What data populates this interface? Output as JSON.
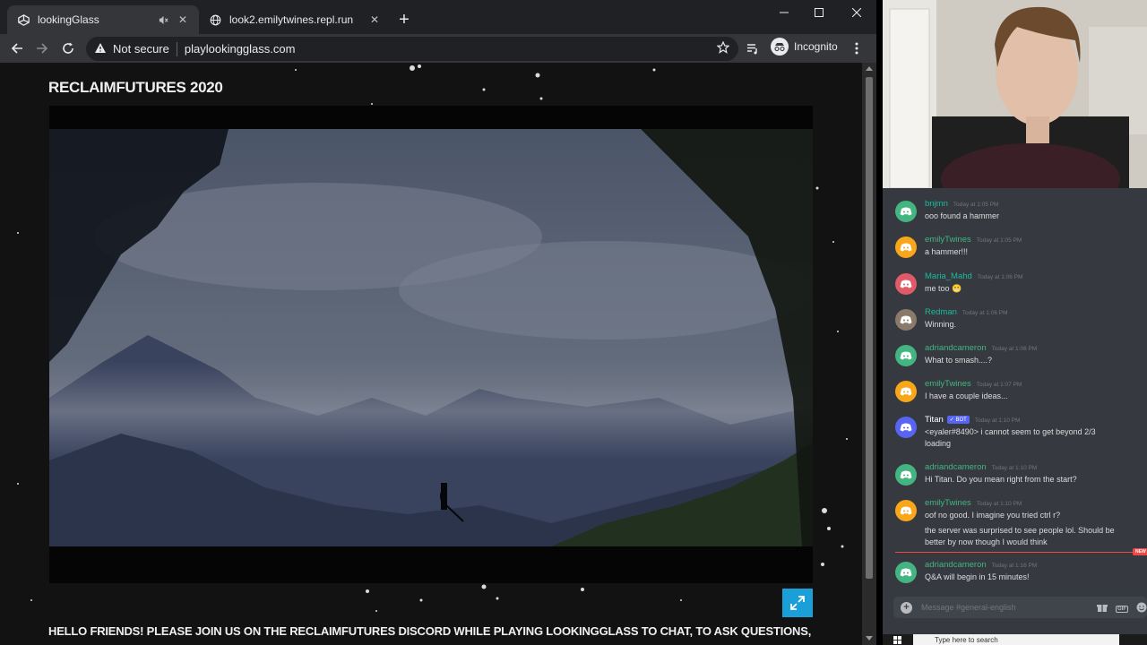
{
  "browser": {
    "tabs": [
      {
        "title": "lookingGlass",
        "active": true,
        "muted": true
      },
      {
        "title": "look2.emilytwines.repl.run",
        "active": false
      }
    ],
    "security_label": "Not secure",
    "url": "playlookingglass.com",
    "profile_label": "Incognito"
  },
  "page": {
    "title": "RECLAIMFUTURES 2020",
    "announcement": "HELLO FRIENDS! PLEASE JOIN US ON THE RECLAIMFUTURES DISCORD WHILE PLAYING LOOKINGGLASS TO CHAT, TO ASK QUESTIONS,"
  },
  "discord": {
    "messages": [
      {
        "author": "bnjmn",
        "name_color": "#1abc9c",
        "avatar_color": "#43b581",
        "time": "Today at 1:05 PM",
        "lines": [
          "ooo found a hammer"
        ]
      },
      {
        "author": "emilyTwines",
        "name_color": "#43b581",
        "avatar_color": "#faa61a",
        "time": "Today at 1:05 PM",
        "lines": [
          "a hammer!!!"
        ]
      },
      {
        "author": "Maria_Mahd",
        "name_color": "#1abc9c",
        "avatar_color": "#e05a6a",
        "time": "Today at 1:06 PM",
        "lines": [
          "me too 😬"
        ]
      },
      {
        "author": "Redman",
        "name_color": "#1abc9c",
        "avatar_color": "#8a7a6a",
        "time": "Today at 1:06 PM",
        "lines": [
          "Winning."
        ]
      },
      {
        "author": "adriandcameron",
        "name_color": "#43b581",
        "avatar_color": "#43b581",
        "time": "Today at 1:06 PM",
        "lines": [
          "What to smash....?"
        ]
      },
      {
        "author": "emilyTwines",
        "name_color": "#43b581",
        "avatar_color": "#faa61a",
        "time": "Today at 1:07 PM",
        "lines": [
          "I have a couple ideas..."
        ]
      },
      {
        "author": "Titan",
        "name_color": "#ffffff",
        "avatar_color": "#5865f2",
        "time": "Today at 1:10 PM",
        "badge": "✓ BOT",
        "lines": [
          "<eyaler#8490> i cannot seem to get beyond 2/3",
          "loading"
        ]
      },
      {
        "author": "adriandcameron",
        "name_color": "#43b581",
        "avatar_color": "#43b581",
        "time": "Today at 1:10 PM",
        "lines": [
          "Hi Titan. Do you mean right from the start?"
        ]
      },
      {
        "author": "emilyTwines",
        "name_color": "#43b581",
        "avatar_color": "#faa61a",
        "time": "Today at 1:10 PM",
        "lines": [
          "oof no good. I imagine you tried ctrl r?",
          "the server was surprised to see people lol. Should be",
          "better by now though I would think"
        ]
      },
      {
        "author": "adriandcameron",
        "name_color": "#43b581",
        "avatar_color": "#43b581",
        "time": "Today at 1:16 PM",
        "lines": [
          "Q&A will begin in 15 minutes!"
        ]
      }
    ],
    "new_tag": "NEW",
    "input_placeholder": "Message #general-english",
    "gif_label": "GIF"
  },
  "taskbar": {
    "search_placeholder": "Type here to search"
  }
}
